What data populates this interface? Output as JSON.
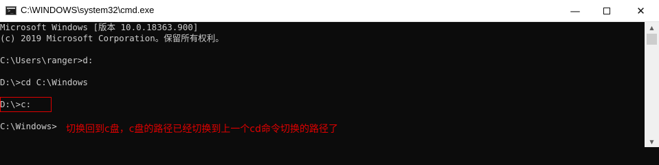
{
  "window": {
    "title": "C:\\WINDOWS\\system32\\cmd.exe",
    "controls": {
      "minimize": "—",
      "close": "✕"
    }
  },
  "console": {
    "lines": [
      "Microsoft Windows [版本 10.0.18363.900]",
      "(c) 2019 Microsoft Corporation。保留所有权利。",
      "",
      "C:\\Users\\ranger>d:",
      "",
      "D:\\>cd C:\\Windows",
      "",
      "D:\\>c:",
      "",
      "C:\\Windows>"
    ]
  },
  "annotation": {
    "text": "切换回到c盘，c盘的路径已经切换到上一个cd命令切换的路径了",
    "color": "#e00000"
  },
  "colors": {
    "console_bg": "#0c0c0c",
    "console_text": "#cccccc",
    "titlebar_bg": "#ffffff",
    "scrollbar_bg": "#f0f0f0"
  },
  "icons": {
    "app": "cmd-icon",
    "scroll_up": "arrow-up-icon",
    "scroll_down": "arrow-down-icon"
  }
}
